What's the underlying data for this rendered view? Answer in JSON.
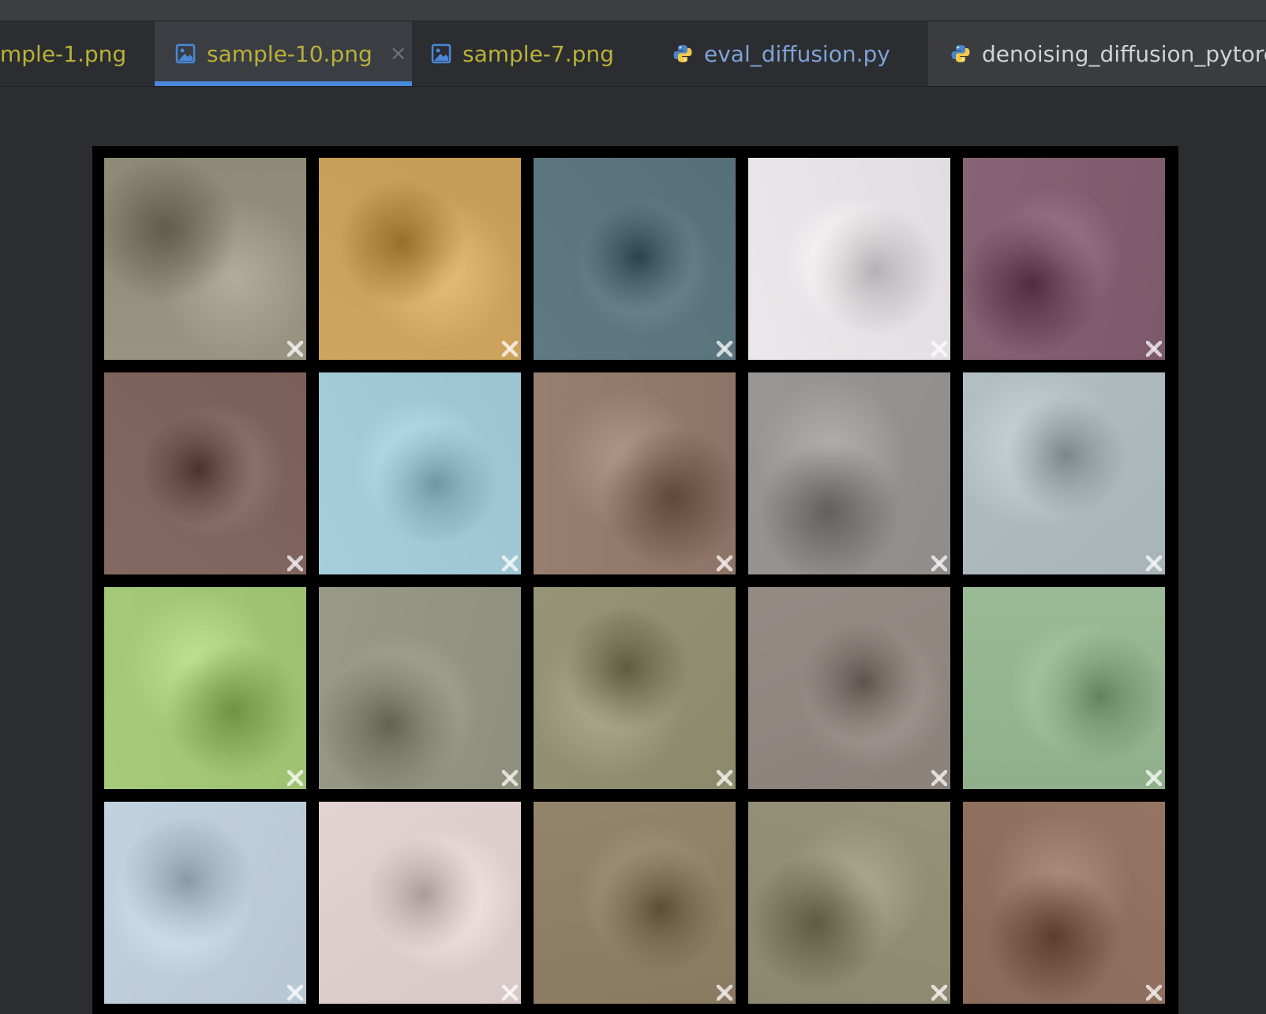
{
  "tabs": [
    {
      "label": "mple-1.png",
      "type": "image",
      "active": false
    },
    {
      "label": "sample-10.png",
      "type": "image",
      "active": true
    },
    {
      "label": "sample-7.png",
      "type": "image",
      "active": false
    },
    {
      "label": "eval_diffusion.py",
      "type": "python",
      "active": false
    },
    {
      "label": "denoising_diffusion_pytorch",
      "type": "python",
      "active": false
    }
  ],
  "colors": {
    "accent": "#4a88d9",
    "image_tab_text": "#b9b23a",
    "python_tab_text": "#7fa3d8"
  },
  "image_grid": {
    "rows": 4,
    "cols": 5,
    "tiles": [
      [
        "#8e8a78",
        "#c59b55",
        "#56707a",
        "#e2dde0",
        "#7c5a6b"
      ],
      [
        "#7a5e58",
        "#9cc3cf",
        "#8e7466",
        "#8f8c8a",
        "#a8b4b8"
      ],
      [
        "#9bc070",
        "#8f8f7d",
        "#8c8a6c",
        "#8a817b",
        "#8fb08a"
      ],
      [
        "#b8c7d4",
        "#d8c8c8",
        "#8a7a62",
        "#8c8870",
        "#8a6a58"
      ]
    ]
  }
}
